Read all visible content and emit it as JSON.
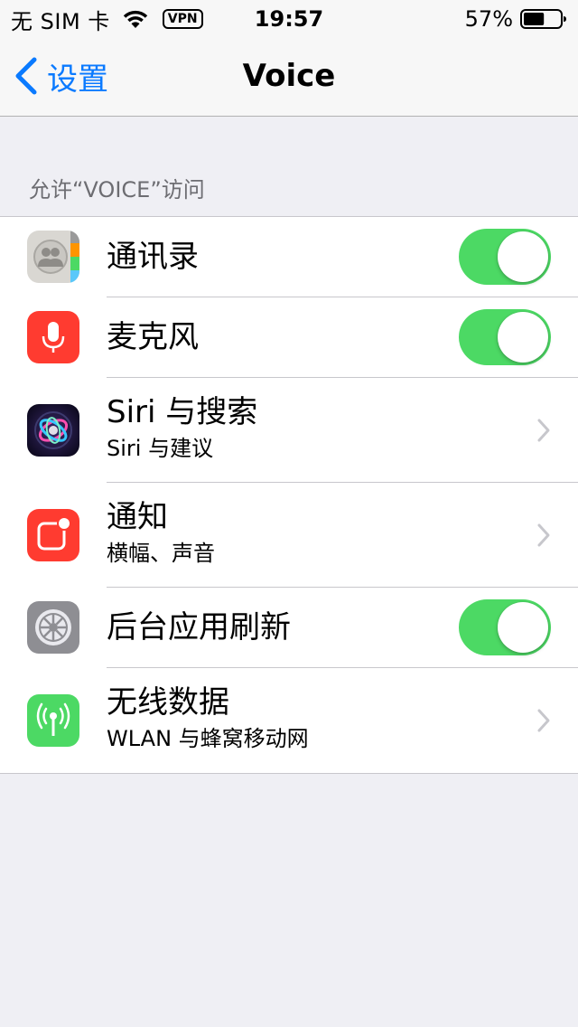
{
  "status_bar": {
    "carrier": "无 SIM 卡",
    "vpn": "VPN",
    "time": "19:57",
    "battery": "57%",
    "battery_level": 0.57
  },
  "nav": {
    "back_label": "设置",
    "title": "Voice"
  },
  "section_header": "允许“VOICE”访问",
  "rows": [
    {
      "title": "通讯录",
      "icon": "contacts-icon",
      "control": "toggle",
      "on": true
    },
    {
      "title": "麦克风",
      "icon": "microphone-icon",
      "control": "toggle",
      "on": true
    },
    {
      "title": "Siri 与搜索",
      "subtitle": "Siri 与建议",
      "icon": "siri-icon",
      "control": "chevron"
    },
    {
      "title": "通知",
      "subtitle": "横幅、声音",
      "icon": "notifications-icon",
      "control": "chevron"
    },
    {
      "title": "后台应用刷新",
      "icon": "gear-icon",
      "control": "toggle",
      "on": true
    },
    {
      "title": "无线数据",
      "subtitle": "WLAN 与蜂窝移动网",
      "icon": "wireless-data-icon",
      "control": "chevron"
    }
  ],
  "colors": {
    "accent": "#0a7aff",
    "toggle_on": "#4cd964",
    "background": "#efeff4"
  }
}
